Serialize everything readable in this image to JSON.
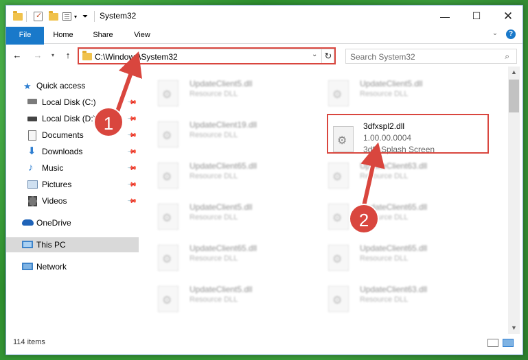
{
  "window": {
    "title": "System32"
  },
  "ribbon": {
    "tabs": [
      "File",
      "Home",
      "Share",
      "View"
    ],
    "collapse_icon": "chevron-down-icon",
    "help_icon": "help-icon"
  },
  "address": {
    "path": "C:\\Windows\\System32",
    "search_placeholder": "Search System32"
  },
  "nav": {
    "items": [
      {
        "label": "Quick access",
        "icon": "star-icon",
        "pinned": false
      },
      {
        "label": "Local Disk (C:)",
        "icon": "drive-icon",
        "pinned": true
      },
      {
        "label": "Local Disk (D:)",
        "icon": "drive-icon",
        "pinned": true
      },
      {
        "label": "Documents",
        "icon": "documents-icon",
        "pinned": true
      },
      {
        "label": "Downloads",
        "icon": "downloads-icon",
        "pinned": true
      },
      {
        "label": "Music",
        "icon": "music-icon",
        "pinned": true
      },
      {
        "label": "Pictures",
        "icon": "pictures-icon",
        "pinned": true
      },
      {
        "label": "Videos",
        "icon": "videos-icon",
        "pinned": true
      },
      {
        "label": "OneDrive",
        "icon": "cloud-icon",
        "pinned": false
      },
      {
        "label": "This PC",
        "icon": "pc-icon",
        "pinned": false,
        "selected": true
      },
      {
        "label": "Network",
        "icon": "network-icon",
        "pinned": false
      }
    ]
  },
  "files": {
    "left": [
      {
        "name": "UpdateClient5.dll",
        "type": "Resource DLL"
      },
      {
        "name": "UpdateClient19.dll",
        "type": "Resource DLL"
      },
      {
        "name": "UpdateClient65.dll",
        "type": "Resource DLL"
      },
      {
        "name": "UpdateClient5.dll",
        "type": "Resource DLL"
      },
      {
        "name": "UpdateClient65.dll",
        "type": "Resource DLL"
      },
      {
        "name": "UpdateClient5.dll",
        "type": "Resource DLL"
      }
    ],
    "right": [
      {
        "name": "UpdateClient5.dll",
        "type": "Resource DLL"
      },
      {
        "name": "UpdateClient63.dll",
        "type": "Resource DLL"
      },
      {
        "name": "UpdateClient65.dll",
        "type": "Resource DLL"
      },
      {
        "name": "UpdateClient65.dll",
        "type": "Resource DLL"
      },
      {
        "name": "UpdateClient63.dll",
        "type": "Resource DLL"
      }
    ],
    "highlighted": {
      "name": "3dfxspl2.dll",
      "version": "1.00.00.0004",
      "description": "3dfx Splash Screen"
    }
  },
  "status": {
    "item_count": "114 items"
  },
  "callouts": [
    "1",
    "2"
  ],
  "colors": {
    "accent": "#1979ca",
    "highlight": "#d9463e",
    "background": "#3a9a3a"
  }
}
